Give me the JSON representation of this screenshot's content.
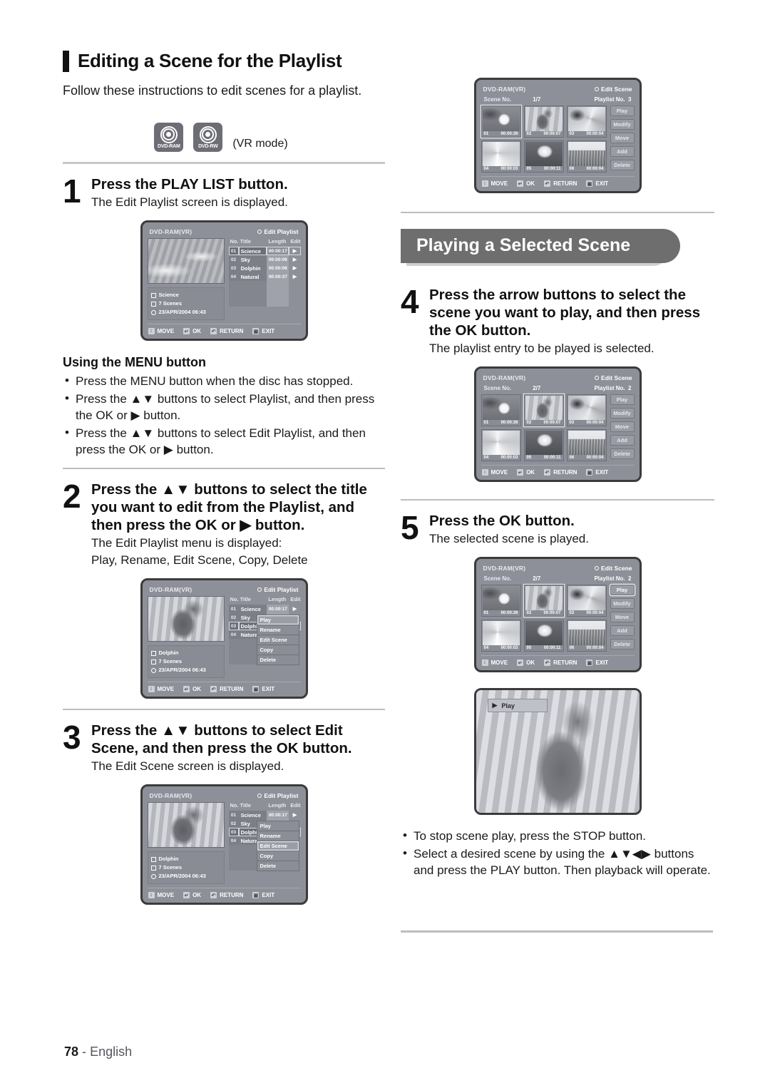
{
  "page": {
    "number": "78",
    "separator": "-",
    "language": "English"
  },
  "left": {
    "heading": "Editing a Scene for the Playlist",
    "lead": "Follow these instructions to edit scenes for a playlist.",
    "discs": [
      {
        "label": "DVD-RAM",
        "name": "dvd-ram-badge"
      },
      {
        "label": "DVD-RW",
        "name": "dvd-rw-badge"
      }
    ],
    "mode_note": "(VR mode)",
    "steps": [
      {
        "num": "1",
        "title": "Press the PLAY LIST button.",
        "sub": "The Edit Playlist screen is displayed."
      },
      {
        "num": "2",
        "title": "Press the ▲▼ buttons to select the title you want to edit from the Playlist, and then press the OK or ▶ button.",
        "sub": "The Edit Playlist menu is displayed:",
        "sub2": "Play, Rename, Edit Scene, Copy, Delete"
      },
      {
        "num": "3",
        "title": "Press the ▲▼ buttons to select Edit Scene, and then press the OK button.",
        "sub": "The Edit Scene screen is displayed."
      }
    ],
    "menu_note": {
      "heading": "Using the MENU button",
      "items": [
        "Press the MENU button when the disc has stopped.",
        "Press the ▲▼ buttons to select Playlist, and then press the OK or ▶ button.",
        "Press the ▲▼ buttons to select Edit Playlist, and then press the OK or ▶ button."
      ]
    }
  },
  "right": {
    "banner": "Playing a Selected Scene",
    "steps": [
      {
        "num": "4",
        "title": "Press the arrow buttons to select the scene you want to play, and then press the OK button.",
        "sub": "The playlist entry to be played is selected."
      },
      {
        "num": "5",
        "title": "Press the OK button.",
        "sub": "The selected scene is played."
      }
    ],
    "notes": [
      "To stop scene play, press the STOP button.",
      "Select a desired scene by using the ▲▼◀▶ buttons and press the PLAY button. Then playback will operate."
    ]
  },
  "osd": {
    "disc_label": "DVD-RAM(VR)",
    "title_edit_playlist": "Edit Playlist",
    "title_edit_scene": "Edit Scene",
    "nav": [
      {
        "icon": "↕",
        "label": "MOVE",
        "name": "osd-move-button"
      },
      {
        "icon": "↵",
        "label": "OK",
        "name": "osd-ok-button"
      },
      {
        "icon": "↶",
        "label": "RETURN",
        "name": "osd-return-button"
      },
      {
        "icon": "▣",
        "label": "EXIT",
        "name": "osd-exit-button"
      }
    ],
    "playlist_columns": {
      "no": "No.",
      "title": "Title",
      "length": "Length",
      "edit": "Edit"
    },
    "playlist_rows": [
      {
        "no": "01",
        "title": "Science",
        "length": "00:00:17"
      },
      {
        "no": "02",
        "title": "Sky",
        "length": "00:00:06"
      },
      {
        "no": "03",
        "title": "Dolphin",
        "length": "00:00:06"
      },
      {
        "no": "04",
        "title": "Natural",
        "length": "00:00:37"
      }
    ],
    "info_science": {
      "title": "Science",
      "scenes": "7 Scenes",
      "date": "23/APR/2004 06:43"
    },
    "info_dolphin": {
      "title": "Dolphin",
      "scenes": "7 Scenes",
      "date": "23/APR/2004 06:43"
    },
    "dropdown_items": [
      "Play",
      "Rename",
      "Edit Scene",
      "Copy",
      "Delete"
    ],
    "scene_labels": {
      "scene_no": "Scene No.",
      "playlist_no": "Playlist No."
    },
    "scene_buttons": [
      "Play",
      "Modify",
      "Move",
      "Add",
      "Delete"
    ],
    "scene_thumbs": [
      {
        "no": "01",
        "time": "00:00:26"
      },
      {
        "no": "02",
        "time": "00:00:07"
      },
      {
        "no": "03",
        "time": "00:00:04"
      },
      {
        "no": "04",
        "time": "00:00:03"
      },
      {
        "no": "05",
        "time": "00:00:11"
      },
      {
        "no": "06",
        "time": "00:00:04"
      }
    ],
    "screen_s3": {
      "counter": "1/7",
      "playlist_no": "3"
    },
    "screen_s4": {
      "counter": "2/7",
      "playlist_no": "2"
    },
    "screen_s5": {
      "counter": "2/7",
      "playlist_no": "2"
    },
    "play_osd_label": "Play"
  }
}
